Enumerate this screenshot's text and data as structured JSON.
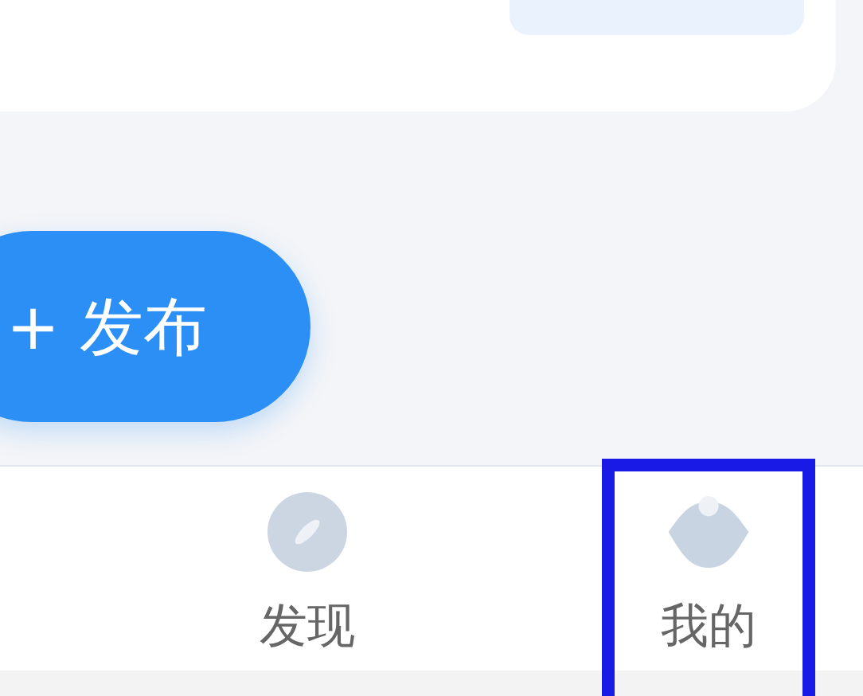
{
  "publish_button": {
    "label": "+ 发布"
  },
  "tab_bar": {
    "tabs": [
      {
        "label": "发现",
        "kind": "discover",
        "selected": false,
        "highlighted": false
      },
      {
        "label": "我的",
        "kind": "profile",
        "selected": false,
        "highlighted": true
      }
    ]
  }
}
